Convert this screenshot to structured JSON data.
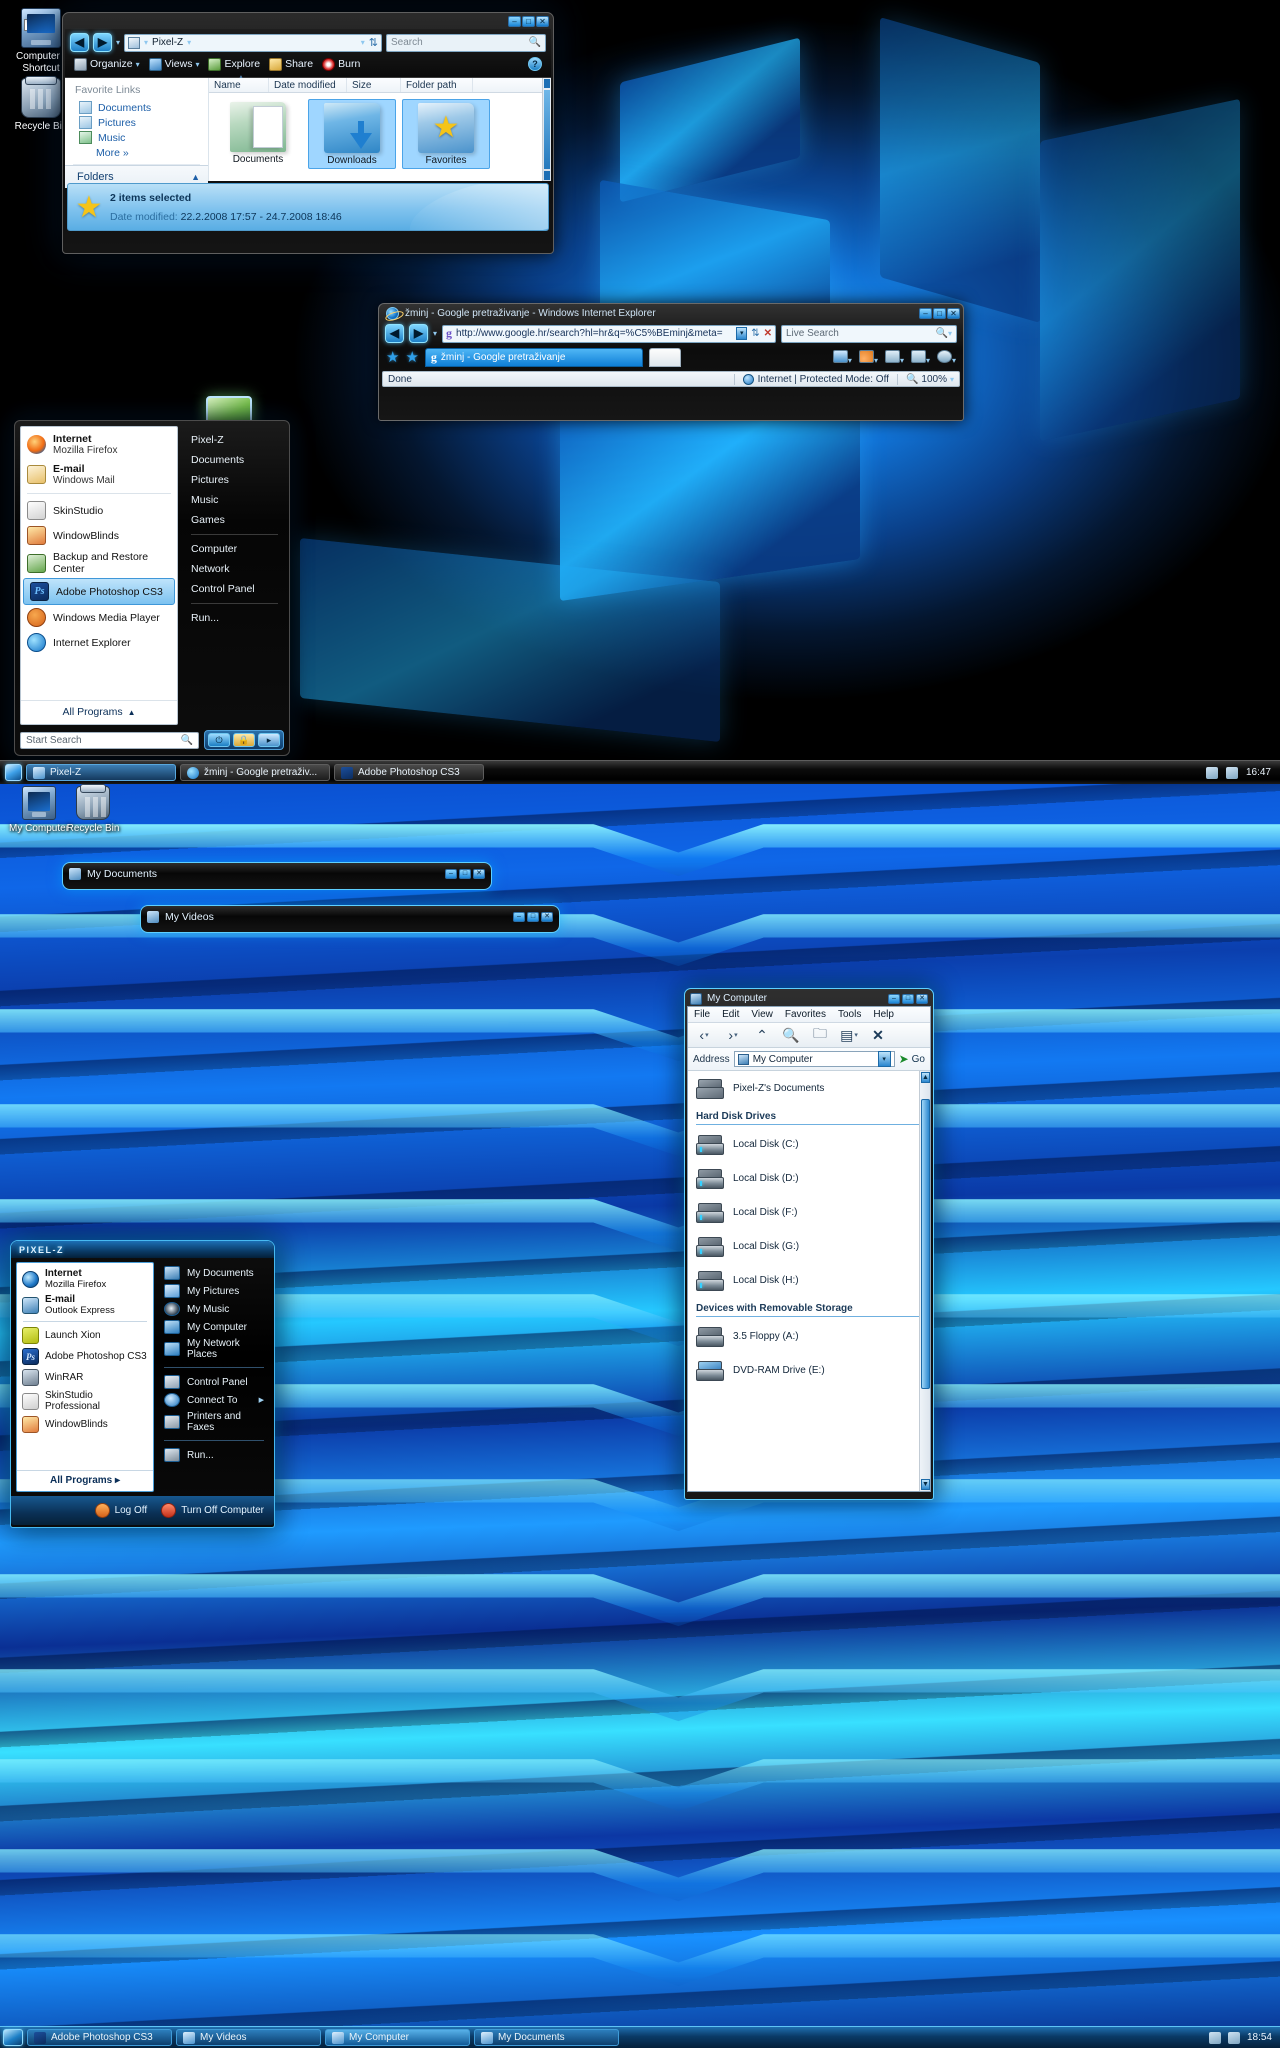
{
  "desktop_icons_top": [
    {
      "label": "Computer - Shortcut",
      "icon": "computer-icon"
    },
    {
      "label": "Recycle Bin",
      "icon": "recycle-bin-icon"
    }
  ],
  "desktop_icons_bottom": [
    {
      "label": "My Computer",
      "icon": "computer-icon"
    },
    {
      "label": "Recycle Bin",
      "icon": "recycle-bin-icon"
    }
  ],
  "explorer": {
    "address": "Pixel-Z",
    "search_placeholder": "Search",
    "nav": {
      "back": "◀",
      "forward": "▶"
    },
    "commands": [
      "Organize",
      "Views",
      "Explore",
      "Share",
      "Burn"
    ],
    "help_label": "?",
    "favorite_links_title": "Favorite Links",
    "favorite_links": [
      "Documents",
      "Pictures",
      "Music"
    ],
    "more_label": "More",
    "folders_label": "Folders",
    "columns": [
      "Name",
      "Date modified",
      "Size",
      "Folder path"
    ],
    "tiles": [
      {
        "label": "Documents",
        "selected": false
      },
      {
        "label": "Downloads",
        "selected": true
      },
      {
        "label": "Favorites",
        "selected": true
      }
    ],
    "details": {
      "selection": "2 items selected",
      "date_label": "Date modified:",
      "date_value": "22.2.2008 17:57 - 24.7.2008 18:46"
    },
    "window_buttons": [
      "–",
      "□",
      "✕"
    ]
  },
  "ie": {
    "title": "žminj - Google pretraživanje - Windows Internet Explorer",
    "url": "http://www.google.hr/search?hl=hr&q=%C5%BEminj&meta=",
    "live_search_placeholder": "Live Search",
    "tab_label": "žminj - Google pretraživanje",
    "status": "Done",
    "zone": "Internet | Protected Mode: Off",
    "zoom": "100%",
    "window_buttons": [
      "–",
      "□",
      "✕"
    ]
  },
  "start_menu_vista": {
    "left_items": [
      {
        "title": "Internet",
        "sub": "Mozilla Firefox",
        "icon": "firefox-icon",
        "highlighted": false
      },
      {
        "title": "E-mail",
        "sub": "Windows Mail",
        "icon": "mail-icon",
        "highlighted": false
      },
      {
        "title": "SkinStudio",
        "sub": "",
        "icon": "skinstudio-icon",
        "highlighted": false
      },
      {
        "title": "WindowBlinds",
        "sub": "",
        "icon": "windowblinds-icon",
        "highlighted": false
      },
      {
        "title": "Backup and Restore Center",
        "sub": "",
        "icon": "backup-icon",
        "highlighted": false
      },
      {
        "title": "Adobe Photoshop CS3",
        "sub": "",
        "icon": "photoshop-icon",
        "highlighted": true
      },
      {
        "title": "Windows Media Player",
        "sub": "",
        "icon": "media-player-icon",
        "highlighted": false
      },
      {
        "title": "Internet Explorer",
        "sub": "",
        "icon": "ie-icon",
        "highlighted": false
      }
    ],
    "all_programs": "All Programs",
    "right_items_1": [
      "Pixel-Z",
      "Documents",
      "Pictures",
      "Music",
      "Games"
    ],
    "right_items_2": [
      "Computer",
      "Network",
      "Control Panel"
    ],
    "right_items_3": [
      "Run..."
    ],
    "search_placeholder": "Start Search",
    "power_buttons": [
      "power-icon",
      "lock-icon",
      "arrow-icon"
    ]
  },
  "taskbar_top": {
    "tasks": [
      {
        "label": "Pixel-Z",
        "icon": "folder-icon",
        "active": true
      },
      {
        "label": "žminj - Google pretraživ...",
        "icon": "ie-icon",
        "active": false
      },
      {
        "label": "Adobe Photoshop CS3",
        "icon": "photoshop-icon",
        "active": false
      }
    ],
    "clock": "16:47"
  },
  "legacy_windows": [
    {
      "title": "My Documents",
      "icon": "folder-icon",
      "buttons": [
        "–",
        "□",
        "✕"
      ]
    },
    {
      "title": "My Videos",
      "icon": "folder-icon",
      "buttons": [
        "–",
        "□",
        "✕"
      ]
    }
  ],
  "my_computer": {
    "title": "My Computer",
    "menus": [
      "File",
      "Edit",
      "View",
      "Favorites",
      "Tools",
      "Help"
    ],
    "toolbar_icons": [
      "back-icon",
      "forward-icon",
      "up-icon",
      "search-icon",
      "folders-icon",
      "views-icon",
      "delete-icon"
    ],
    "address_label": "Address",
    "address_value": "My Computer",
    "go_label": "Go",
    "top_item": {
      "label": "Pixel-Z's Documents",
      "icon": "documents-folder-icon"
    },
    "groups": [
      {
        "title": "Hard Disk Drives",
        "items": [
          {
            "label": "Local Disk (C:)",
            "icon": "hard-drive-icon"
          },
          {
            "label": "Local Disk (D:)",
            "icon": "hard-drive-icon"
          },
          {
            "label": "Local Disk (F:)",
            "icon": "hard-drive-icon"
          },
          {
            "label": "Local Disk (G:)",
            "icon": "hard-drive-icon"
          },
          {
            "label": "Local Disk (H:)",
            "icon": "hard-drive-icon"
          }
        ]
      },
      {
        "title": "Devices with Removable Storage",
        "items": [
          {
            "label": "3.5 Floppy (A:)",
            "icon": "floppy-icon"
          },
          {
            "label": "DVD-RAM Drive (E:)",
            "icon": "dvd-drive-icon"
          }
        ]
      }
    ],
    "window_buttons": [
      "–",
      "□",
      "✕"
    ]
  },
  "start_menu_xp": {
    "logo": "PIXEL-Z",
    "left_items": [
      {
        "title": "Internet",
        "sub": "Mozilla Firefox",
        "icon": "ie-icon"
      },
      {
        "title": "E-mail",
        "sub": "Outlook Express",
        "icon": "outlook-express-icon"
      },
      {
        "title": "Launch Xion",
        "sub": "",
        "icon": "xion-icon"
      },
      {
        "title": "Adobe Photoshop CS3",
        "sub": "",
        "icon": "photoshop-icon"
      },
      {
        "title": "WinRAR",
        "sub": "",
        "icon": "winrar-icon"
      },
      {
        "title": "SkinStudio Professional",
        "sub": "",
        "icon": "skinstudio-icon"
      },
      {
        "title": "WindowBlinds",
        "sub": "",
        "icon": "windowblinds-icon"
      }
    ],
    "all_programs": "All Programs",
    "right_items_1": [
      {
        "label": "My Documents",
        "icon": "documents-icon",
        "submenu": false
      },
      {
        "label": "My Pictures",
        "icon": "pictures-icon",
        "submenu": false
      },
      {
        "label": "My Music",
        "icon": "music-icon",
        "submenu": false
      },
      {
        "label": "My Computer",
        "icon": "computer-icon",
        "submenu": false
      },
      {
        "label": "My Network Places",
        "icon": "network-icon",
        "submenu": false
      }
    ],
    "right_items_2": [
      {
        "label": "Control Panel",
        "icon": "control-panel-icon",
        "submenu": false
      },
      {
        "label": "Connect To",
        "icon": "connect-icon",
        "submenu": true
      },
      {
        "label": "Printers and Faxes",
        "icon": "printer-icon",
        "submenu": false
      }
    ],
    "right_items_3": [
      {
        "label": "Run...",
        "icon": "run-icon",
        "submenu": false
      }
    ],
    "log_off": "Log Off",
    "turn_off": "Turn Off Computer"
  },
  "taskbar_bottom": {
    "tasks": [
      {
        "label": "Adobe Photoshop CS3",
        "icon": "photoshop-icon",
        "active": false
      },
      {
        "label": "My Videos",
        "icon": "folder-icon",
        "active": false
      },
      {
        "label": "My Computer",
        "icon": "computer-icon",
        "active": true
      },
      {
        "label": "My Documents",
        "icon": "folder-icon",
        "active": false
      }
    ],
    "clock": "18:54"
  },
  "colors": {
    "accent": "#2b87cf",
    "glow": "#5fd0ff",
    "selection": "#9fd6ff"
  }
}
